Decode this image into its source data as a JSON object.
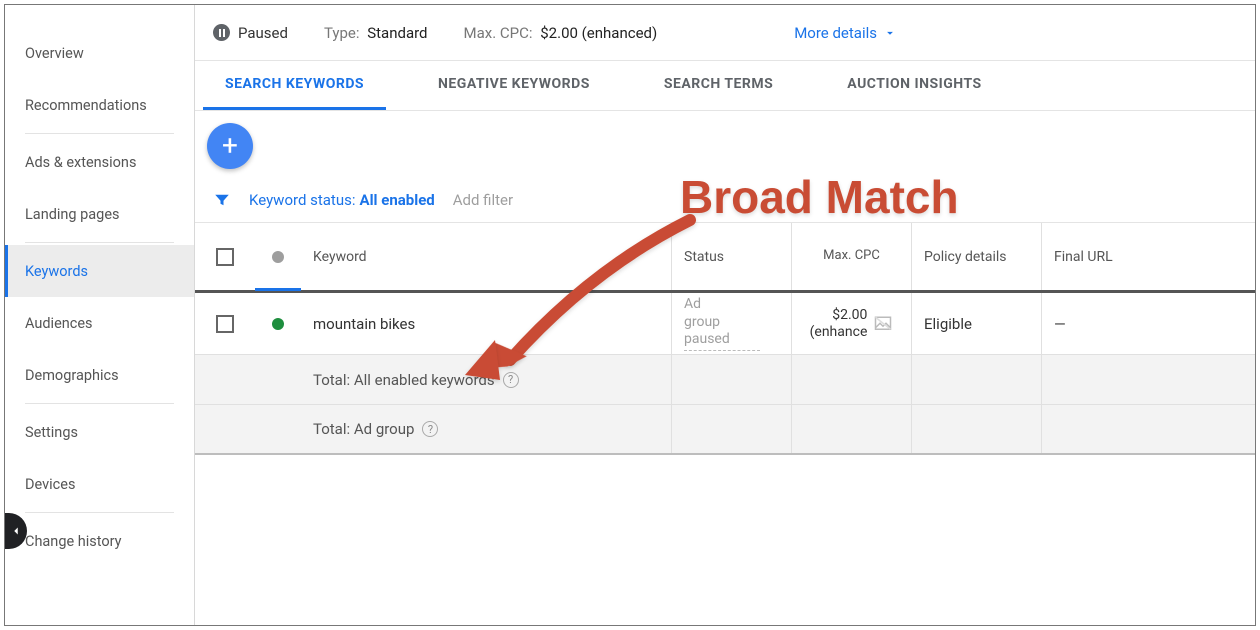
{
  "sidebar": {
    "items": [
      "Overview",
      "Recommendations",
      "Ads & extensions",
      "Landing pages",
      "Keywords",
      "Audiences",
      "Demographics",
      "Settings",
      "Devices",
      "Change history"
    ],
    "active_index": 4
  },
  "header": {
    "status_label": "Paused",
    "type_label": "Type:",
    "type_value": "Standard",
    "cpc_label": "Max. CPC:",
    "cpc_value": "$2.00 (enhanced)",
    "more_details": "More details"
  },
  "tabs": {
    "items": [
      "SEARCH KEYWORDS",
      "NEGATIVE KEYWORDS",
      "SEARCH TERMS",
      "AUCTION INSIGHTS"
    ],
    "active_index": 0
  },
  "filter": {
    "label": "Keyword status:",
    "value": "All enabled",
    "add_filter": "Add filter"
  },
  "table": {
    "columns": {
      "keyword": "Keyword",
      "status": "Status",
      "max_cpc": "Max. CPC",
      "policy": "Policy details",
      "final_url": "Final URL"
    },
    "rows": [
      {
        "keyword": "mountain bikes",
        "status": "Ad group paused",
        "max_cpc": "$2.00 (enhance",
        "policy": "Eligible",
        "final_url": "—",
        "dot_color": "green"
      }
    ],
    "summaries": [
      "Total: All enabled keywords",
      "Total: Ad group"
    ]
  },
  "annotation": {
    "text": "Broad Match"
  }
}
